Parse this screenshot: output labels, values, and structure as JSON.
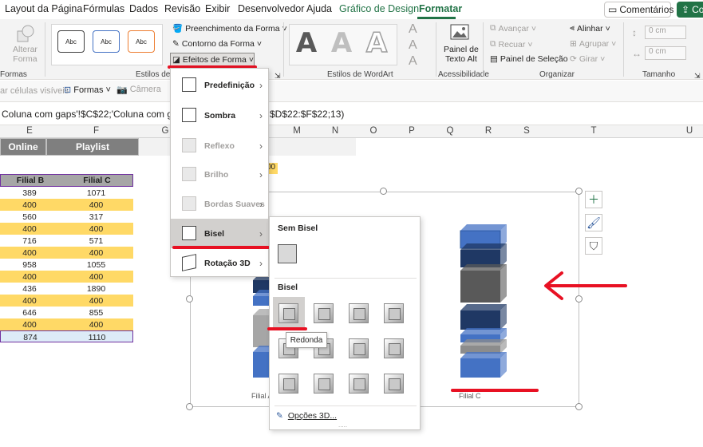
{
  "tabs": [
    "Layout da Página",
    "Fórmulas",
    "Dados",
    "Revisão",
    "Exibir",
    "Desenvolvedor",
    "Ajuda",
    "Gráfico de Design",
    "Formatar"
  ],
  "active_tab": "Formatar",
  "top_right": {
    "comments": "Comentários",
    "share": "Co"
  },
  "ribbon": {
    "insert_shapes": {
      "change_shape": "Alterar",
      "change_shape2": "Forma",
      "group_label": "Formas"
    },
    "shape_styles": {
      "style_text": "Abc",
      "fill": "Preenchimento da Forma",
      "outline": "Contorno da Forma",
      "effects": "Efeitos de Forma",
      "group_label": "Estilos de Fo"
    },
    "wordart": {
      "letter": "A",
      "group_label": "Estilos de WordArt"
    },
    "accessibility": {
      "alt_text1": "Painel de",
      "alt_text2": "Texto Alt",
      "group_label": "Acessibilidade"
    },
    "arrange": {
      "forward": "Avançar",
      "backward": "Recuar",
      "selection_pane": "Painel de Seleção",
      "align": "Alinhar",
      "group": "Agrupar",
      "rotate": "Girar",
      "group_label": "Organizar"
    },
    "size": {
      "height": "0 cm",
      "width": "0 cm",
      "group_label": "Tamanho"
    }
  },
  "toolbar2": {
    "visible_cells": "ar células visíveis",
    "shapes": "Formas",
    "camera": "Câmera"
  },
  "formula_bar": {
    "text": "Coluna com gaps'!$C$22;'Coluna com gaps'!$D$",
    "text_tail": "$D$22:$F$22;13)"
  },
  "columns": [
    "E",
    "F",
    "G",
    "M",
    "N",
    "O",
    "P",
    "Q",
    "R",
    "S",
    "T",
    "U"
  ],
  "sheet": {
    "header_buttons": [
      "Online",
      "Playlist"
    ],
    "table_headers": [
      "Filial B",
      "Filial C"
    ],
    "rows": [
      [
        "389",
        "1071"
      ],
      [
        "400",
        "400"
      ],
      [
        "560",
        "317"
      ],
      [
        "400",
        "400"
      ],
      [
        "716",
        "571"
      ],
      [
        "400",
        "400"
      ],
      [
        "958",
        "1055"
      ],
      [
        "400",
        "400"
      ],
      [
        "436",
        "1890"
      ],
      [
        "400",
        "400"
      ],
      [
        "646",
        "855"
      ],
      [
        "400",
        "400"
      ],
      [
        "874",
        "1110"
      ]
    ],
    "cell_fragment": "00"
  },
  "chart": {
    "label_a": "Filial A",
    "label_c": "Filial C"
  },
  "effects_menu": {
    "items": [
      {
        "label": "Predefinição",
        "enabled": true
      },
      {
        "label": "Sombra",
        "enabled": true
      },
      {
        "label": "Reflexo",
        "enabled": false
      },
      {
        "label": "Brilho",
        "enabled": false
      },
      {
        "label": "Bordas Suaves",
        "enabled": false
      },
      {
        "label": "Bisel",
        "enabled": true
      },
      {
        "label": "Rotação 3D",
        "enabled": true
      }
    ]
  },
  "bevel_menu": {
    "no_bevel": "Sem Bisel",
    "bevel": "Bisel",
    "tooltip": "Redonda",
    "options_3d": "Opções 3D...",
    "more": "....."
  },
  "colors": {
    "excel_green": "#217346",
    "annotation_red": "#e81123",
    "yellow_row": "#ffd966",
    "blue_bar": "#4472c4",
    "dark_blue_bar": "#1f3864",
    "gray_bar": "#595959"
  }
}
